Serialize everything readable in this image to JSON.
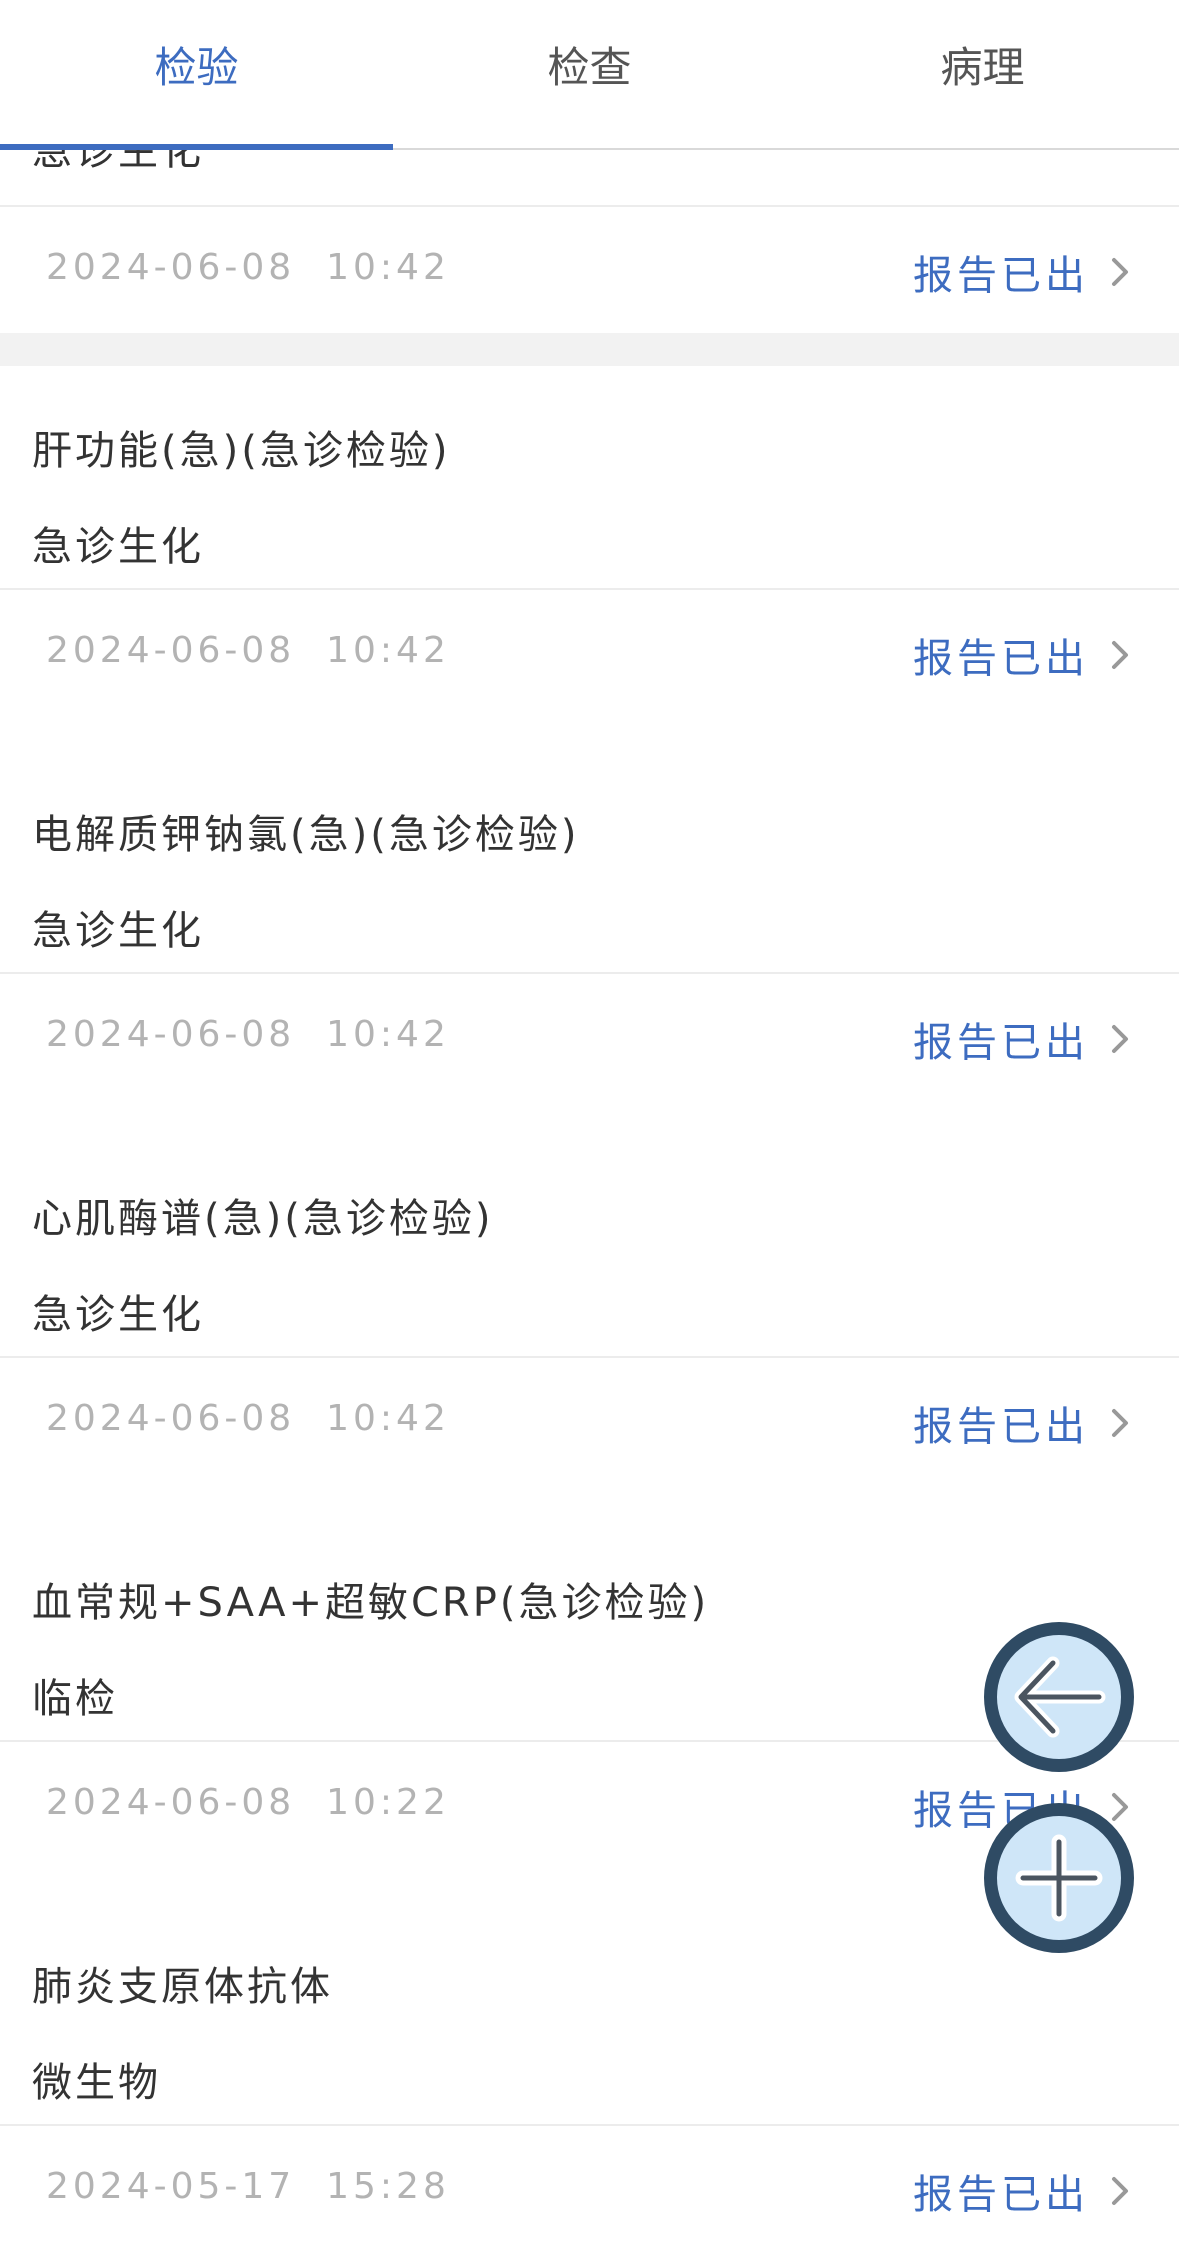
{
  "tabs": [
    {
      "label": "检验",
      "active": true
    },
    {
      "label": "检查",
      "active": false
    },
    {
      "label": "病理",
      "active": false
    }
  ],
  "partial_item": {
    "category": "急诊生化",
    "datetime": "2024-06-08  10:42",
    "status": "报告已出"
  },
  "items": [
    {
      "title": "肝功能(急)(急诊检验)",
      "category": "急诊生化",
      "datetime": "2024-06-08  10:42",
      "status": "报告已出"
    },
    {
      "title": "电解质钾钠氯(急)(急诊检验)",
      "category": "急诊生化",
      "datetime": "2024-06-08  10:42",
      "status": "报告已出"
    },
    {
      "title": "心肌酶谱(急)(急诊检验)",
      "category": "急诊生化",
      "datetime": "2024-06-08  10:42",
      "status": "报告已出"
    },
    {
      "title": "血常规+SAA+超敏CRP(急诊检验)",
      "category": "临检",
      "datetime": "2024-06-08  10:22",
      "status": "报告已出"
    },
    {
      "title": "肺炎支原体抗体",
      "category": "微生物",
      "datetime": "2024-05-17  15:28",
      "status": "报告已出"
    }
  ],
  "fab": {
    "back_icon": "arrow-left-icon",
    "add_icon": "plus-icon"
  },
  "colors": {
    "accent": "#3d6cc0",
    "date_text": "#b3b3b3",
    "fab_fill": "#cfe6f8",
    "fab_border": "#2f4b64"
  }
}
